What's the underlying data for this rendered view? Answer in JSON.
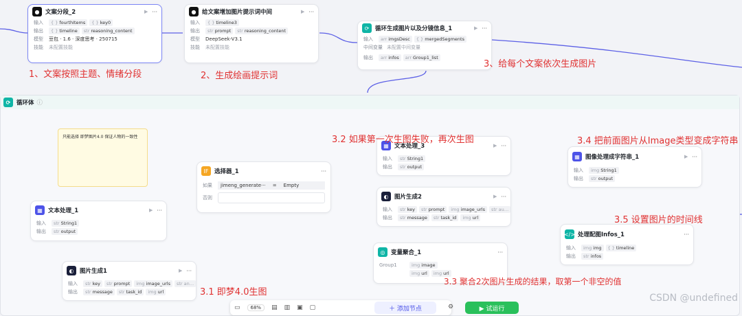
{
  "nodes": {
    "seg": {
      "title": "文案分段_2",
      "in_label": "输入",
      "in": [
        {
          "t": "{ }",
          "v": "fourthItems"
        },
        {
          "t": "{ }",
          "v": "key0"
        }
      ],
      "out_label": "输出",
      "out": [
        {
          "t": "{ }",
          "v": "timeline"
        },
        {
          "t": "str",
          "v": "reasoning_content"
        }
      ],
      "model_label": "模型",
      "model": "豆包 · 1.6 · 深度思考 · 250715",
      "skill_label": "技能",
      "skill": "未配置技能"
    },
    "prompt": {
      "title": "给文案增加图片提示词中间",
      "in_label": "输入",
      "in": [
        {
          "t": "{ }",
          "v": "timeline3"
        }
      ],
      "out_label": "输出",
      "out": [
        {
          "t": "str",
          "v": "prompt"
        },
        {
          "t": "str",
          "v": "reasoning_content"
        }
      ],
      "model_label": "模型",
      "model": "DeepSeek-V3.1",
      "skill_label": "技能",
      "skill": "未配置技能"
    },
    "loopgen": {
      "title": "循环生成图片以及分镜信息_1",
      "in_label": "输入",
      "in": [
        {
          "t": "arr",
          "v": "imgsDesc"
        },
        {
          "t": "{ }",
          "v": "mergedSegments"
        }
      ],
      "mid_label": "中间变量",
      "mid": "未配置中间变量",
      "out_label": "输出",
      "out": [
        {
          "t": "arr",
          "v": "infos"
        },
        {
          "t": "arr",
          "v": "Group1_list"
        }
      ]
    },
    "text1": {
      "title": "文本处理_1",
      "in_label": "输入",
      "in": [
        {
          "t": "str",
          "v": "String1"
        }
      ],
      "out_label": "输出",
      "out": [
        {
          "t": "str",
          "v": "output"
        }
      ]
    },
    "img1": {
      "title": "图片生成1",
      "in_label": "输入",
      "in": [
        {
          "t": "str",
          "v": "key"
        },
        {
          "t": "str",
          "v": "prompt"
        },
        {
          "t": "img",
          "v": "image_urls"
        },
        {
          "t": "str",
          "v": "an…"
        }
      ],
      "out_label": "输出",
      "out": [
        {
          "t": "str",
          "v": "message"
        },
        {
          "t": "str",
          "v": "task_id"
        },
        {
          "t": "img",
          "v": "url"
        }
      ]
    },
    "selector": {
      "title": "选择器_1",
      "if_label": "如果",
      "cond_left": "jimeng_generate···",
      "cond_op": "=",
      "cond_right": "Empty",
      "else_label": "否则"
    },
    "text3": {
      "title": "文本处理_3",
      "in_label": "输入",
      "in": [
        {
          "t": "str",
          "v": "String1"
        }
      ],
      "out_label": "输出",
      "out": [
        {
          "t": "str",
          "v": "output"
        }
      ]
    },
    "img2": {
      "title": "图片生成2",
      "in_label": "输入",
      "in": [
        {
          "t": "str",
          "v": "key"
        },
        {
          "t": "str",
          "v": "prompt"
        },
        {
          "t": "img",
          "v": "image_urls"
        },
        {
          "t": "str",
          "v": "au…"
        }
      ],
      "out_label": "输出",
      "out": [
        {
          "t": "str",
          "v": "message"
        },
        {
          "t": "str",
          "v": "task_id"
        },
        {
          "t": "img",
          "v": "url"
        }
      ]
    },
    "agg": {
      "title": "变量聚合_1",
      "group_label": "Group1",
      "items": [
        {
          "t": "img",
          "v": "image"
        },
        {
          "t": "img",
          "v": "url"
        },
        {
          "t": "img",
          "v": "url"
        }
      ]
    },
    "imgstr": {
      "title": "图像处理成字符串_1",
      "in_label": "输入",
      "in": [
        {
          "t": "img",
          "v": "String1"
        }
      ],
      "out_label": "输出",
      "out": [
        {
          "t": "str",
          "v": "output"
        }
      ]
    },
    "infos": {
      "title": "处理配图Infos_1",
      "in_label": "输入",
      "in": [
        {
          "t": "img",
          "v": "img"
        },
        {
          "t": "{ }",
          "v": "timeline"
        }
      ],
      "out_label": "输出",
      "out": [
        {
          "t": "str",
          "v": "infos"
        }
      ]
    }
  },
  "loop": {
    "title": "循环体",
    "info_icon": "ⓘ"
  },
  "note_text": "只能选择 即梦图片4.0 保证人物的一致性",
  "annotations": {
    "a1": "1、文案按照主题、情绪分段",
    "a2": "2、生成绘画提示词",
    "a3": "3、给每个文案依次生成图片",
    "a31": "3.1 即梦4.0生图",
    "a32": "3.2 如果第一次生图失败，再次生图",
    "a33": "3.3 聚合2次图片生成的结果，取第一个非空的值",
    "a34": "3.4 把前面图片从Image类型变成字符串",
    "a35": "3.5 设置图片的时间线"
  },
  "toolbar": {
    "zoom": "68%",
    "add_node": "＋ 添加节点",
    "try_run": "▶ 试运行"
  },
  "watermark": "CSDN @undefined",
  "colors": {
    "accent": "#4d53e8",
    "annotation": "#e03131",
    "run": "#2ac05b"
  }
}
